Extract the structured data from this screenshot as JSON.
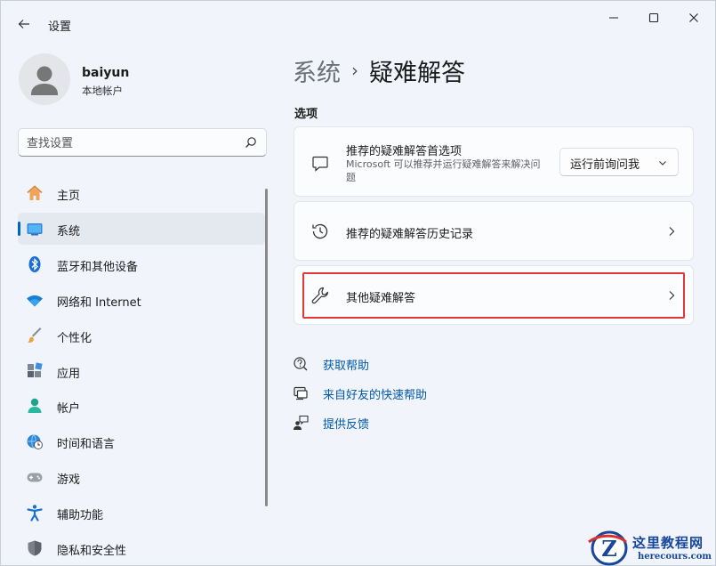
{
  "window": {
    "title": "设置",
    "icons": [
      "back-arrow-icon",
      "minimize-icon",
      "maximize-icon",
      "close-icon"
    ]
  },
  "profile": {
    "name": "baiyun",
    "account_type": "本地帐户"
  },
  "search": {
    "placeholder": "查找设置"
  },
  "nav": {
    "selected_index": 1,
    "accent": "#0067c0",
    "items": [
      {
        "label": "主页",
        "icon": "home-icon"
      },
      {
        "label": "系统",
        "icon": "system-display-icon"
      },
      {
        "label": "蓝牙和其他设备",
        "icon": "bluetooth-icon"
      },
      {
        "label": "网络和 Internet",
        "icon": "wifi-icon"
      },
      {
        "label": "个性化",
        "icon": "paintbrush-icon"
      },
      {
        "label": "应用",
        "icon": "apps-icon"
      },
      {
        "label": "帐户",
        "icon": "account-icon"
      },
      {
        "label": "时间和语言",
        "icon": "globe-clock-icon"
      },
      {
        "label": "游戏",
        "icon": "gamepad-icon"
      },
      {
        "label": "辅助功能",
        "icon": "accessibility-icon"
      },
      {
        "label": "隐私和安全性",
        "icon": "shield-icon"
      }
    ]
  },
  "main": {
    "breadcrumb": {
      "parent": "系统",
      "separator": "›",
      "current": "疑难解答"
    },
    "section_title": "选项",
    "cards": [
      {
        "title": "推荐的疑难解答首选项",
        "description": "Microsoft 可以推荐并运行疑难解答来解决问题",
        "icon": "chat-bubble-icon",
        "dropdown_value": "运行前询问我"
      },
      {
        "title": "推荐的疑难解答历史记录",
        "icon": "history-icon"
      },
      {
        "title": "其他疑难解答",
        "icon": "wrench-icon",
        "highlighted": true,
        "highlight_color": "#e0373b"
      }
    ],
    "help_links": [
      {
        "label": "获取帮助",
        "icon": "help-chat-icon"
      },
      {
        "label": "来自好友的快速帮助",
        "icon": "remote-assist-icon"
      },
      {
        "label": "提供反馈",
        "icon": "feedback-icon"
      }
    ]
  },
  "watermark": {
    "name": "这里教程网",
    "url": "herecours.com",
    "color": "#16479a"
  }
}
